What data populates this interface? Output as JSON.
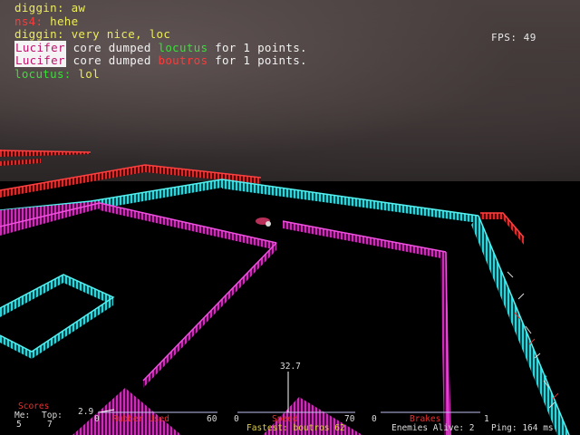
{
  "chat": [
    {
      "name": "diggin:",
      "name_color": "yellow",
      "text": " aw",
      "text_color": "yellow"
    },
    {
      "name": "ns4:",
      "name_color": "red",
      "text": " hehe",
      "text_color": "yellow"
    },
    {
      "name": "diggin:",
      "name_color": "yellow",
      "text": " very nice, loc",
      "text_color": "yellow"
    },
    {
      "kill": true,
      "killer": "Lucifer",
      "verb": " core dumped ",
      "victim": "locutus",
      "victim_color": "green",
      "suffix": " for 1 points."
    },
    {
      "kill": true,
      "killer": "Lucifer",
      "verb": " core dumped ",
      "victim": "boutros",
      "victim_color": "red",
      "suffix": " for 1 points."
    },
    {
      "name": "locutus:",
      "name_color": "green",
      "text": " lol",
      "text_color": "yellow"
    }
  ],
  "fps": {
    "label": "FPS:",
    "value": "49"
  },
  "hud": {
    "scores_label": "Scores",
    "me_label": "Me:",
    "me_value": "5",
    "top_label": "Top:",
    "top_value": "7",
    "rubber_value": "2.9",
    "rubber_min": "0",
    "rubber_label": "Rubber Used",
    "rubber_max": "60",
    "speed_value": "32.7",
    "speed_min": "0",
    "speed_label": "Speed",
    "speed_max": "70",
    "brakes_min": "0",
    "brakes_label": "Brakes",
    "brakes_max": "1",
    "fastest": "Fastest: boutros 62",
    "enemies": "Enemies Alive: 2",
    "ping": "Ping: 164 ms"
  },
  "colors": {
    "cyan": "#2ad6dc",
    "magenta": "#d02ab8",
    "red": "#e02828",
    "sky": "#3c3434"
  }
}
